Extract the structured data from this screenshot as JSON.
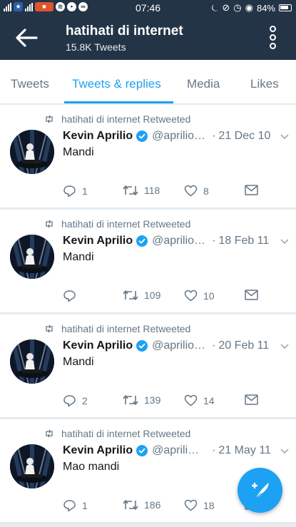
{
  "status_bar": {
    "time": "07:46",
    "battery": "84%",
    "icons": [
      "signal-icon",
      "star-app-icon",
      "signal-icon",
      "app-badge-icon",
      "spotify-icon",
      "chat-icon",
      "blackberry-messenger-icon",
      "alarm-icon",
      "notification-icon",
      "clock-icon",
      "eye-icon",
      "battery-icon"
    ]
  },
  "header": {
    "title": "hatihati di internet",
    "subtitle": "15.8K Tweets"
  },
  "tabs": [
    {
      "label": "Tweets",
      "active": false
    },
    {
      "label": "Tweets & replies",
      "active": true
    },
    {
      "label": "Media",
      "active": false
    },
    {
      "label": "Likes",
      "active": false
    }
  ],
  "colors": {
    "accent": "#1da1f2",
    "header_bg": "#243447",
    "secondary_text": "#657786"
  },
  "tweets": [
    {
      "retweet_label": "hatihati di internet Retweeted",
      "name": "Kevin Aprilio",
      "handle": "@aprilio…",
      "date": "21 Dec 10",
      "text": "Mandi",
      "replies": "1",
      "retweets": "118",
      "likes": "8"
    },
    {
      "retweet_label": "hatihati di internet Retweeted",
      "name": "Kevin Aprilio",
      "handle": "@aprilio…",
      "date": "18 Feb 11",
      "text": "Mandi",
      "replies": "",
      "retweets": "109",
      "likes": "10"
    },
    {
      "retweet_label": "hatihati di internet Retweeted",
      "name": "Kevin Aprilio",
      "handle": "@aprilio…",
      "date": "20 Feb 11",
      "text": "Mandi",
      "replies": "2",
      "retweets": "139",
      "likes": "14"
    },
    {
      "retweet_label": "hatihati di internet Retweeted",
      "name": "Kevin Aprilio",
      "handle": "@aprili…",
      "date": "21 May 11",
      "text": "Mao mandi",
      "replies": "1",
      "retweets": "186",
      "likes": "18"
    }
  ]
}
